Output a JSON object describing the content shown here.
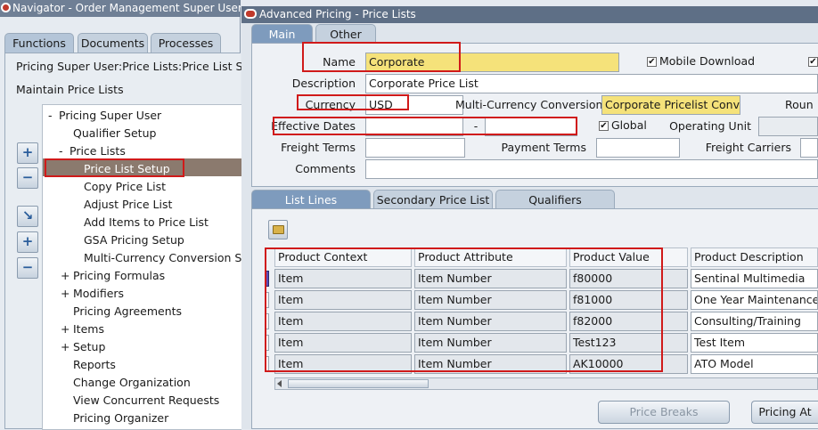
{
  "navigator": {
    "title": "Navigator - Order Management Super User, Vis",
    "tabs": [
      "Functions",
      "Documents",
      "Processes"
    ],
    "responsibility": "Pricing Super User:Price Lists:Price List Se",
    "heading": "Maintain Price Lists",
    "tree": [
      {
        "prefix": "-",
        "label": "Pricing Super User"
      },
      {
        "prefix": "",
        "label": "Qualifier Setup"
      },
      {
        "prefix": "-",
        "label": "Price Lists"
      },
      {
        "prefix": "",
        "label": "Price List Setup"
      },
      {
        "prefix": "",
        "label": "Copy Price List"
      },
      {
        "prefix": "",
        "label": "Adjust Price List"
      },
      {
        "prefix": "",
        "label": "Add Items to Price List"
      },
      {
        "prefix": "",
        "label": "GSA Pricing Setup"
      },
      {
        "prefix": "",
        "label": "Multi-Currency Conversion Set"
      },
      {
        "prefix": "+",
        "label": "Pricing Formulas"
      },
      {
        "prefix": "+",
        "label": "Modifiers"
      },
      {
        "prefix": "",
        "label": "Pricing Agreements"
      },
      {
        "prefix": "+",
        "label": "Items"
      },
      {
        "prefix": "+",
        "label": "Setup"
      },
      {
        "prefix": "",
        "label": "Reports"
      },
      {
        "prefix": "",
        "label": "Change Organization"
      },
      {
        "prefix": "",
        "label": "View Concurrent Requests"
      },
      {
        "prefix": "",
        "label": "Pricing Organizer"
      }
    ],
    "side_buttons": [
      "+",
      "−",
      "↘",
      "+",
      "−"
    ]
  },
  "form": {
    "title": "Advanced Pricing - Price Lists",
    "tabs": [
      "Main",
      "Other"
    ],
    "labels": {
      "name": "Name",
      "description": "Description",
      "currency": "Currency",
      "multi_currency": "Multi-Currency Conversion",
      "rounding": "Roun",
      "effective_dates": "Effective Dates",
      "dash": "-",
      "operating_unit": "Operating Unit",
      "freight_terms": "Freight Terms",
      "payment_terms": "Payment Terms",
      "freight_carriers": "Freight Carriers",
      "comments": "Comments",
      "mobile_download": "Mobile Download",
      "global": "Global"
    },
    "values": {
      "name": "Corporate",
      "description": "Corporate Price List",
      "currency": "USD",
      "multi_currency": "Corporate Pricelist Convers"
    },
    "checkbox_mark": "✔",
    "lower_tabs": [
      "List Lines",
      "Secondary Price List",
      "Qualifiers"
    ],
    "table": {
      "columns": [
        "Product Context",
        "Product Attribute",
        "Product Value",
        "Product Description"
      ],
      "rows": [
        [
          "Item",
          "Item Number",
          "f80000",
          "Sentinal Multimedia"
        ],
        [
          "Item",
          "Item Number",
          "f81000",
          "One Year Maintenance -"
        ],
        [
          "Item",
          "Item Number",
          "f82000",
          "Consulting/Training"
        ],
        [
          "Item",
          "Item Number",
          "Test123",
          "Test Item"
        ],
        [
          "Item",
          "Item Number",
          "AK10000",
          "ATO Model"
        ]
      ]
    },
    "buttons": {
      "price_breaks": "Price Breaks",
      "pricing_attributes": "Pricing At"
    }
  },
  "colors": {
    "title_bar": "#5e6f86",
    "highlight": "#d01a1a",
    "selected_row": "#8b7a6e",
    "yellow_field": "#f5e27a"
  }
}
